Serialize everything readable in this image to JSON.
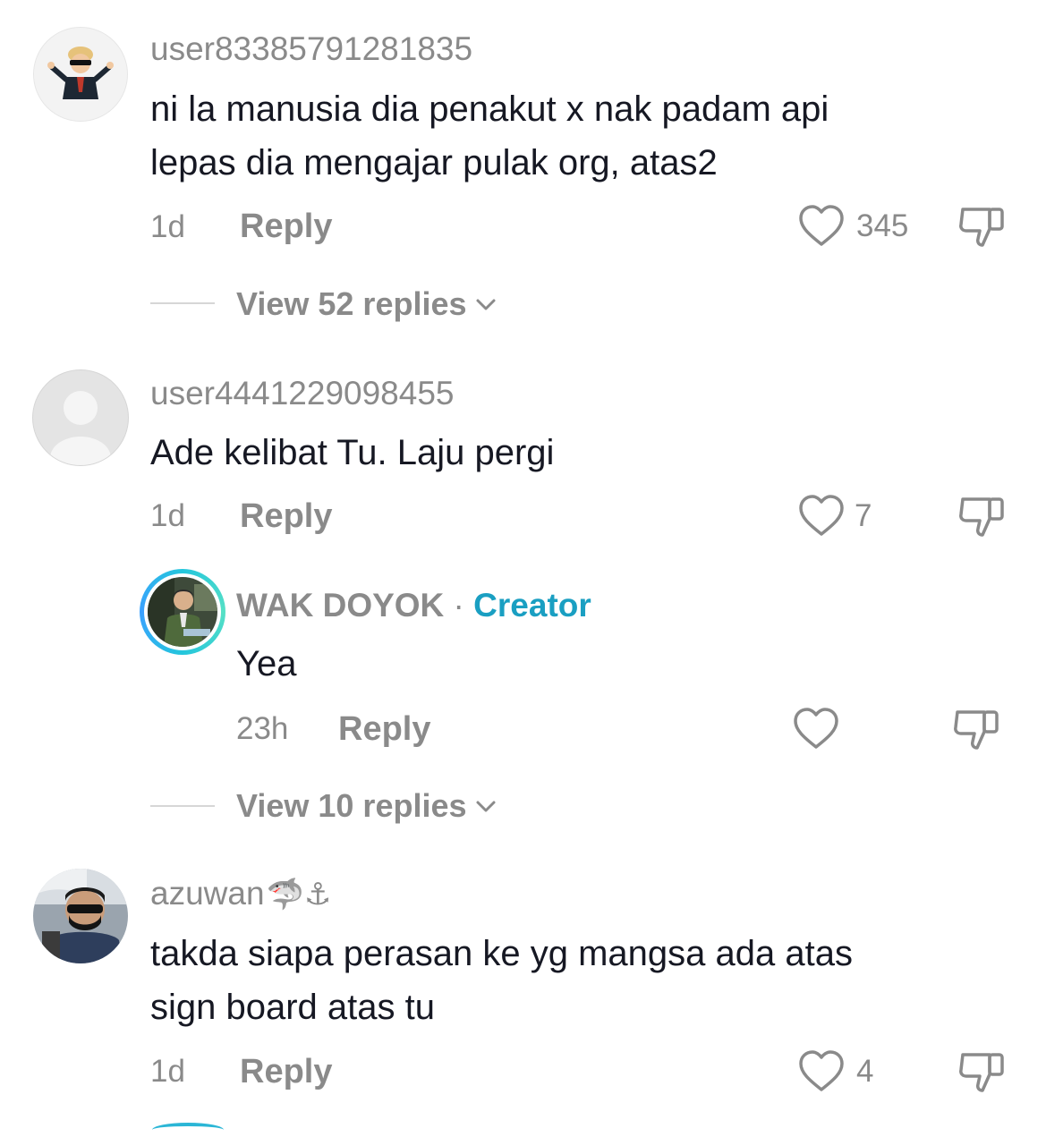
{
  "comments": [
    {
      "username": "user83385791281835",
      "text_lines": [
        "ni la manusia dia penakut x nak padam api",
        "lepas dia mengajar pulak org, atas2"
      ],
      "time": "1d",
      "reply_label": "Reply",
      "likes": "345",
      "view_replies": "View 52 replies"
    },
    {
      "username": "user4441229098455",
      "text_lines": [
        "Ade kelibat Tu. Laju pergi"
      ],
      "time": "1d",
      "reply_label": "Reply",
      "likes": "7",
      "reply": {
        "username": "WAK DOYOK",
        "separator": " · ",
        "badge": "Creator",
        "text": "Yea",
        "time": "23h",
        "reply_label": "Reply"
      },
      "view_replies": "View 10 replies"
    },
    {
      "username": "azuwan",
      "username_emoji": "🦈⚓",
      "text_lines": [
        "takda siapa perasan ke yg mangsa ada atas",
        "sign board atas tu"
      ],
      "time": "1d",
      "reply_label": "Reply",
      "likes": "4"
    }
  ],
  "colors": {
    "creator": "#1a9fc2",
    "muted": "#8a8a8a",
    "text": "#161823"
  }
}
